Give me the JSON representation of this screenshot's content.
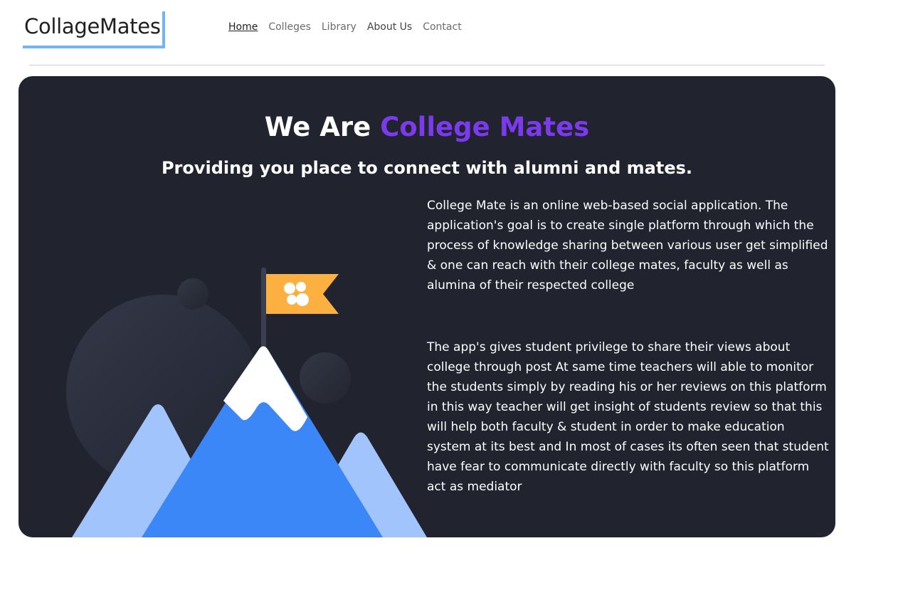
{
  "header": {
    "logo_text": "CollageMates",
    "nav": [
      {
        "label": "Home",
        "active": true
      },
      {
        "label": "Colleges",
        "active": false
      },
      {
        "label": "Library",
        "active": false
      },
      {
        "label": "About Us",
        "active": false
      },
      {
        "label": "Contact",
        "active": false
      }
    ]
  },
  "hero": {
    "title_prefix": "We Are ",
    "title_accent": "College Mates",
    "subtitle": "Providing you place to connect with alumni and mates.",
    "paragraph_1": "College Mate is an online web-based social application. The application's goal is to create single platform through which the process of knowledge sharing between various user get simplified & one can reach with their college mates, faculty as well as alumina of their respected college",
    "paragraph_2": "The app's gives student privilege to share their views about college through post At same time teachers will able to monitor the students simply by reading his or her reviews on this platform in this way teacher will get insight of students review so that this will help both faculty & student in order to make education system at its best and In most of cases its often seen that student have fear to communicate directly with faculty so this platform act as mediator"
  },
  "colors": {
    "hero_bg": "#21232f",
    "accent_purple": "#7c3aed",
    "logo_border": "#74b4f0",
    "mountain_light": "#a0c4fb",
    "mountain_main": "#3b87f7",
    "flag": "#fbb040"
  },
  "icons": {
    "illustration": "mountain-flag-illustration"
  }
}
